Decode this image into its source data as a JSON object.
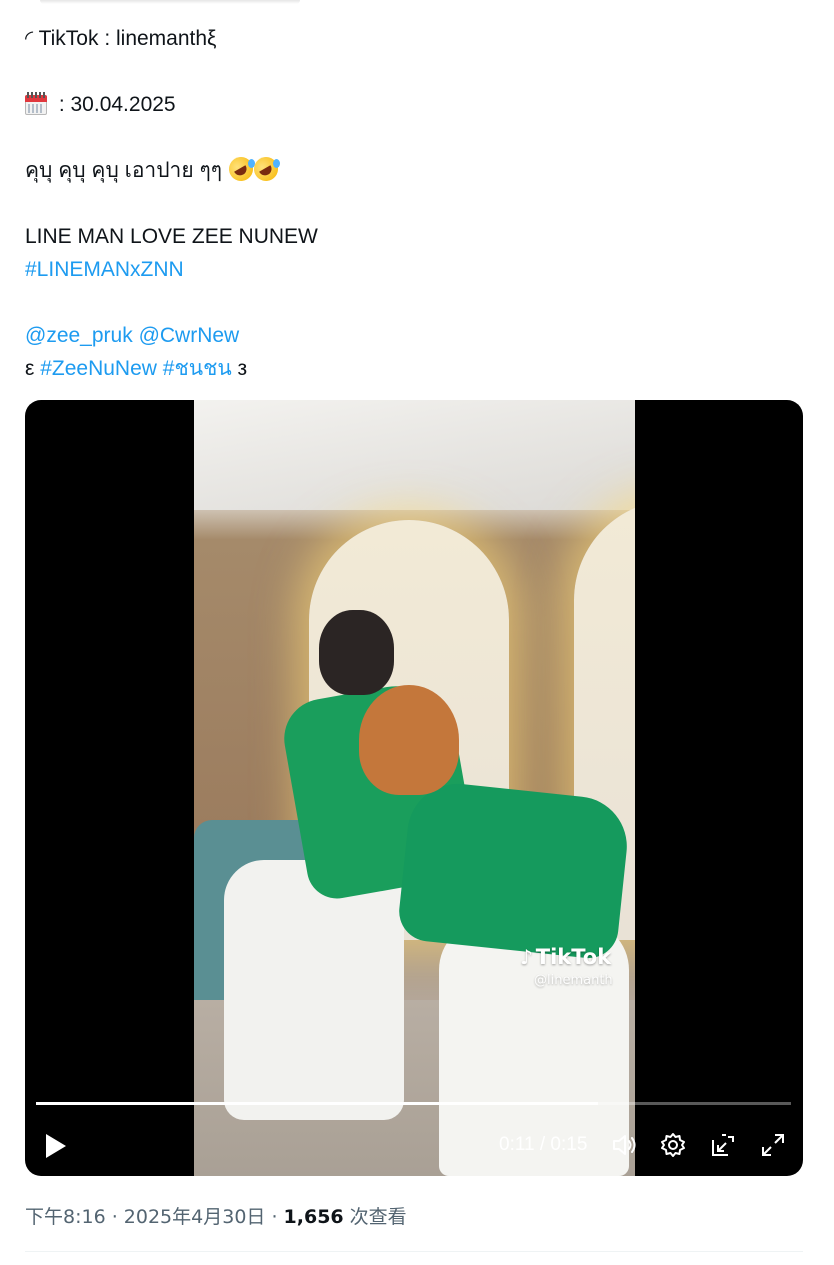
{
  "tweet": {
    "line1": "◜ TikTok : linemanthξ",
    "date_line": " : 30.04.2025",
    "thai_line": "คุบุ คุบุ คุบุ เอาปาย ๆๆ ",
    "title_line": "LINE MAN LOVE ZEE NUNEW",
    "hashtag_lineman": "#LINEMANxZNN",
    "mention_zee": "@zee_pruk",
    "mention_new": "@CwrNew",
    "brace_open": "ε ",
    "hashtag_zeenunew": "#ZeeNuNew",
    "hashtag_thai": "#ชนชน",
    "brace_close": " з",
    "emojis": [
      "calendar-emoji",
      "rolling-on-floor-laughing-emoji",
      "rolling-on-floor-laughing-emoji"
    ]
  },
  "video": {
    "watermark_logo": "TikTok",
    "watermark_handle": "@linemanth",
    "current_time": "0:11",
    "duration": "0:15",
    "time_display": "0:11 / 0:15",
    "progress_fraction": 0.745,
    "icons": [
      "play-icon",
      "volume-icon",
      "settings-gear-icon",
      "pop-out-icon",
      "fullscreen-icon"
    ]
  },
  "meta": {
    "time_date": "下午8:16 · 2025年4月30日 · ",
    "views_count": "1,656",
    "views_label": " 次查看"
  },
  "colors": {
    "link": "#1d9bf0",
    "text": "#0f1419",
    "muted": "#536471",
    "video_bg": "#000000"
  }
}
